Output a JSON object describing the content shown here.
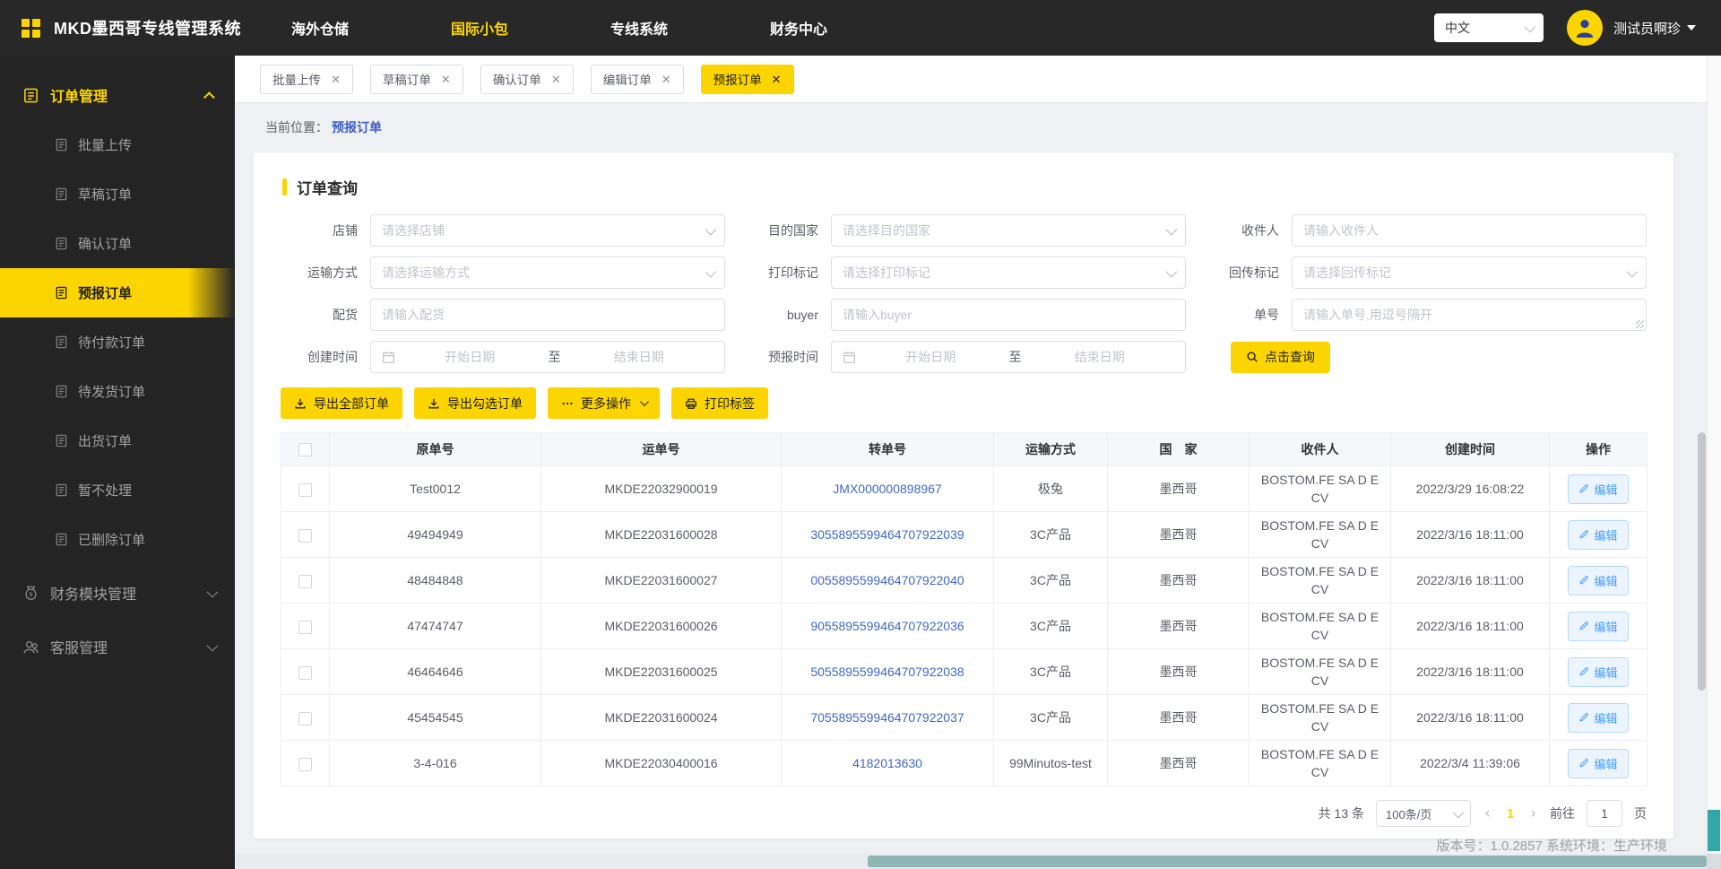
{
  "colors": {
    "accent_yellow": "#fcd500",
    "link_blue": "#4068c5",
    "breadcrumb_blue": "#3a5fc8",
    "edit_button_blue": "#409eff",
    "scrollbar_teal": "#33a7a7"
  },
  "topbar": {
    "title": "MKD墨西哥专线管理系统",
    "nav": [
      {
        "label": "海外仓储"
      },
      {
        "label": "国际小包"
      },
      {
        "label": "专线系统"
      },
      {
        "label": "财务中心"
      }
    ],
    "language": "中文",
    "username": "测试员啊珍"
  },
  "sidebar": {
    "group_orders": "订单管理",
    "items": [
      {
        "label": "批量上传"
      },
      {
        "label": "草稿订单"
      },
      {
        "label": "确认订单"
      },
      {
        "label": "预报订单"
      },
      {
        "label": "待付款订单"
      },
      {
        "label": "待发货订单"
      },
      {
        "label": "出货订单"
      },
      {
        "label": "暂不处理"
      },
      {
        "label": "已删除订单"
      }
    ],
    "group_finance": "财务模块管理",
    "group_service": "客服管理"
  },
  "tabs": [
    {
      "label": "批量上传"
    },
    {
      "label": "草稿订单"
    },
    {
      "label": "确认订单"
    },
    {
      "label": "编辑订单"
    },
    {
      "label": "预报订单"
    }
  ],
  "breadcrumb": {
    "prefix": "当前位置：",
    "current": "预报订单"
  },
  "query": {
    "title": "订单查询",
    "shop": {
      "label": "店铺",
      "placeholder": "请选择店铺"
    },
    "dest_country": {
      "label": "目的国家",
      "placeholder": "请选择目的国家"
    },
    "receiver": {
      "label": "收件人",
      "placeholder": "请输入收件人"
    },
    "shipping": {
      "label": "运输方式",
      "placeholder": "请选择运输方式"
    },
    "print_mark": {
      "label": "打印标记",
      "placeholder": "请选择打印标记"
    },
    "return_mark": {
      "label": "回传标记",
      "placeholder": "请选择回传标记"
    },
    "allocation": {
      "label": "配货",
      "placeholder": "请输入配货"
    },
    "buyer": {
      "label": "buyer",
      "placeholder": "请输入buyer"
    },
    "order_no": {
      "label": "单号",
      "placeholder": "请输入单号,用逗号隔开"
    },
    "create_time": {
      "label": "创建时间",
      "start": "开始日期",
      "to": "至",
      "end": "结束日期"
    },
    "forecast_time": {
      "label": "预报时间",
      "start": "开始日期",
      "to": "至",
      "end": "结束日期"
    },
    "search_label": "点击查询"
  },
  "actions": {
    "export_all": "导出全部订单",
    "export_checked": "导出勾选订单",
    "more": "更多操作",
    "print_label": "打印标签"
  },
  "table": {
    "columns": {
      "original_no": "原单号",
      "tracking_no": "运单号",
      "transfer_no": "转单号",
      "shipping": "运输方式",
      "country": "国　家",
      "receiver": "收件人",
      "created": "创建时间",
      "operation": "操作"
    },
    "edit_label": "编辑",
    "rows": [
      {
        "original_no": "Test0012",
        "tracking_no": "MKDE22032900019",
        "transfer_no": "JMX000000898967",
        "shipping": "极兔",
        "country": "墨西哥",
        "receiver": "BOSTOM.FE SA D E CV",
        "created": "2022/3/29 16:08:22"
      },
      {
        "original_no": "49494949",
        "tracking_no": "MKDE22031600028",
        "transfer_no": "3055895599464707922039",
        "shipping": "3C产品",
        "country": "墨西哥",
        "receiver": "BOSTOM.FE SA D E CV",
        "created": "2022/3/16 18:11:00"
      },
      {
        "original_no": "48484848",
        "tracking_no": "MKDE22031600027",
        "transfer_no": "0055895599464707922040",
        "shipping": "3C产品",
        "country": "墨西哥",
        "receiver": "BOSTOM.FE SA D E CV",
        "created": "2022/3/16 18:11:00"
      },
      {
        "original_no": "47474747",
        "tracking_no": "MKDE22031600026",
        "transfer_no": "9055895599464707922036",
        "shipping": "3C产品",
        "country": "墨西哥",
        "receiver": "BOSTOM.FE SA D E CV",
        "created": "2022/3/16 18:11:00"
      },
      {
        "original_no": "46464646",
        "tracking_no": "MKDE22031600025",
        "transfer_no": "5055895599464707922038",
        "shipping": "3C产品",
        "country": "墨西哥",
        "receiver": "BOSTOM.FE SA D E CV",
        "created": "2022/3/16 18:11:00"
      },
      {
        "original_no": "45454545",
        "tracking_no": "MKDE22031600024",
        "transfer_no": "7055895599464707922037",
        "shipping": "3C产品",
        "country": "墨西哥",
        "receiver": "BOSTOM.FE SA D E CV",
        "created": "2022/3/16 18:11:00"
      },
      {
        "original_no": "3-4-016",
        "tracking_no": "MKDE22030400016",
        "transfer_no": "4182013630",
        "shipping": "99Minutos-test",
        "country": "墨西哥",
        "receiver": "BOSTOM.FE SA D E CV",
        "created": "2022/3/4 11:39:06"
      }
    ]
  },
  "pagination": {
    "total": "共 13 条",
    "page_size": "100条/页",
    "prev": "‹",
    "current_page": "1",
    "next": "›",
    "goto_prefix": "前往",
    "goto_value": "1",
    "goto_suffix": "页"
  },
  "footer": {
    "version_line": "版本号：1.0.2857 系统环境：生产环境"
  }
}
